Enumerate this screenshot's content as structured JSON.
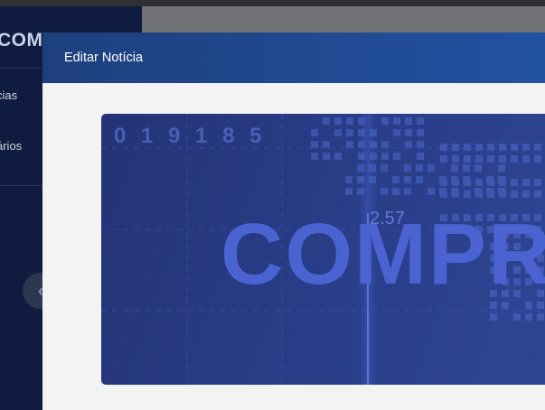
{
  "sidebar": {
    "logo_text": "COMPRAS MA",
    "items": [
      {
        "label": "cias"
      },
      {
        "label": "ários"
      }
    ],
    "collapse_icon": "chevron-left-icon"
  },
  "modal": {
    "title": "Editar Notícia",
    "banner": {
      "ticker_digits": "0 1 9 1 8 5",
      "ticker_value": "2.57",
      "headline": "COMPRAS MA"
    }
  },
  "colors": {
    "sidebar_bg": "#0f1c3f",
    "modal_header": "#2252a2",
    "banner_bg": "#2a3e8a",
    "banner_text": "#4a63d1"
  }
}
